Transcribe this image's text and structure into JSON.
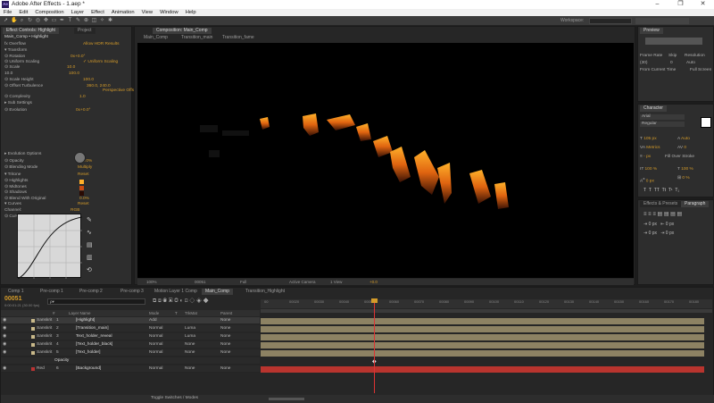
{
  "app": {
    "title": "Adobe After Effects - 1.aep *",
    "logo": "Ae"
  },
  "window_controls": [
    "–",
    "❐",
    "✕"
  ],
  "menu": [
    "File",
    "Edit",
    "Composition",
    "Layer",
    "Effect",
    "Animation",
    "View",
    "Window",
    "Help"
  ],
  "effect_panel": {
    "tabs": [
      "Effect Controls: Highlight",
      "Project"
    ],
    "header": "Main_Comp • Highlight",
    "rows": [
      {
        "label": "fx Overflow",
        "value": "Allow HDR Results"
      },
      {
        "label": "▾ Transform",
        "value": ""
      },
      {
        "label": "    ⊙ Rotation",
        "value": "0x+0.0°"
      },
      {
        "label": "    ⊙ Uniform Scaling",
        "value": "✓ Uniform Scaling"
      },
      {
        "label": "    ⊙ Scale",
        "value": "10.0"
      },
      {
        "label": "    10.0",
        "value": "100.0"
      },
      {
        "label": "    ⊙ Scale Height",
        "value": "100.0"
      },
      {
        "label": "    ⊙ Offset Turbulence",
        "value": "360.0, 240.0"
      },
      {
        "label": "",
        "value": "Perspective Offset"
      },
      {
        "label": "  ⊙ Complexity",
        "value": "1.0"
      },
      {
        "label": "  ▸ Sub Settings",
        "value": ""
      },
      {
        "label": "  ⊙ Evolution",
        "value": "0x+0.0°"
      },
      {
        "label": "▸ Evolution Options",
        "value": ""
      },
      {
        "label": "  ⊙ Opacity",
        "value": "100.0%"
      },
      {
        "label": "  ⊙ Blending Mode",
        "value": "Multiply"
      },
      {
        "label": "▾ Tritone",
        "value": "Reset"
      },
      {
        "label": "  ⊙ Highlights",
        "value": ""
      },
      {
        "label": "  ⊙ Midtones",
        "value": ""
      },
      {
        "label": "  ⊙ Shadows",
        "value": ""
      },
      {
        "label": "  ⊙ Blend With Original",
        "value": "0.0%"
      },
      {
        "label": "▾ Curves",
        "value": "Reset"
      },
      {
        "label": "  Channel:",
        "value": "RGB"
      },
      {
        "label": "  ⊙ Curves",
        "value": ""
      }
    ]
  },
  "composition": {
    "tab": "Composition: Main_Comp",
    "subtabs": [
      "Main_Comp",
      "Transition_main",
      "Transition_fame"
    ],
    "footer": [
      "100%",
      "00051",
      "Full",
      "Active Camera",
      "1 View",
      "+0.0"
    ]
  },
  "preview_panel": {
    "tab": "Preview",
    "frame_rate_label": "Frame Rate",
    "skip_label": "Skip",
    "resolution_label": "Resolution",
    "frame_rate": "(30)",
    "skip": "0",
    "resolution": "Auto",
    "from_current": "From Current Time",
    "full_screen": "Full Screen"
  },
  "character_panel": {
    "tab": "Character",
    "font": "Arial",
    "style": "Regular",
    "size": "105 px",
    "leading": "Auto",
    "tracking": "0",
    "kerning": "Metrics",
    "stroke": "- px",
    "stroke_mode": "Fill Over Stroke",
    "vscale": "100 %",
    "hscale": "100 %",
    "baseline": "0 px",
    "tsume": "0 %",
    "styles": [
      "T",
      "T",
      "TT",
      "Tt",
      "T¹",
      "T₁"
    ]
  },
  "align_panel": {
    "tabs": [
      "Effects & Presets",
      "Paragraph"
    ]
  },
  "timeline": {
    "tabs": [
      "Comp 1",
      "Pre-comp 1",
      "Pre-comp 2",
      "Pre-comp 3",
      "Motion Layer 1 Comp",
      "Main_Comp",
      "Transition_Highlight"
    ],
    "time": "00051",
    "time_sub": "0:00:01:21 (30.00 fps)",
    "search_placeholder": "ρ▾",
    "columns": [
      "#",
      "Layer Name",
      "Mode",
      "T",
      "TrkMat",
      "Parent"
    ],
    "ticks": [
      "00",
      "00020",
      "00030",
      "00040",
      "00050",
      "00060",
      "00070",
      "00080",
      "00090",
      "00100",
      "00110",
      "00120",
      "00130",
      "00140",
      "00150",
      "00160",
      "00170",
      "00180"
    ],
    "layers": [
      {
        "num": "1",
        "label": "Sanskrit",
        "name": "[Highlight]",
        "mode": "Add",
        "trk": "",
        "parent": "None",
        "color": "#c9b98a"
      },
      {
        "num": "2",
        "label": "Sanskrit",
        "name": "[Transition_main]",
        "mode": "Normal",
        "trk": "Luma",
        "parent": "None",
        "color": "#c9b98a"
      },
      {
        "num": "3",
        "label": "Sanskrit",
        "name": "Text_holder_reveal",
        "mode": "Normal",
        "trk": "Luma",
        "parent": "None",
        "color": "#c9b98a"
      },
      {
        "num": "4",
        "label": "Sanskrit",
        "name": "[Text_holder_black]",
        "mode": "Normal",
        "trk": "None",
        "parent": "None",
        "color": "#c9b98a"
      },
      {
        "num": "5",
        "label": "Sanskrit",
        "name": "[Text_holder]",
        "mode": "Normal",
        "trk": "None",
        "parent": "None",
        "color": "#c9b98a"
      },
      {
        "num": "",
        "label": "",
        "name": "Opacity",
        "mode": "",
        "trk": "",
        "parent": "",
        "color": "#8a8a8a"
      },
      {
        "num": "6",
        "label": "Red",
        "name": "[Background]",
        "mode": "Normal",
        "trk": "None",
        "parent": "None",
        "color": "#b33"
      }
    ],
    "footer": "Toggle Switches / Modes"
  },
  "workspace_label": "Workspace:",
  "colors": {
    "accent": "#d49b2a",
    "bar": "#8d8263",
    "red_bar": "#b9342e",
    "playhead": "#d33",
    "bg": "#1d1d1d"
  }
}
